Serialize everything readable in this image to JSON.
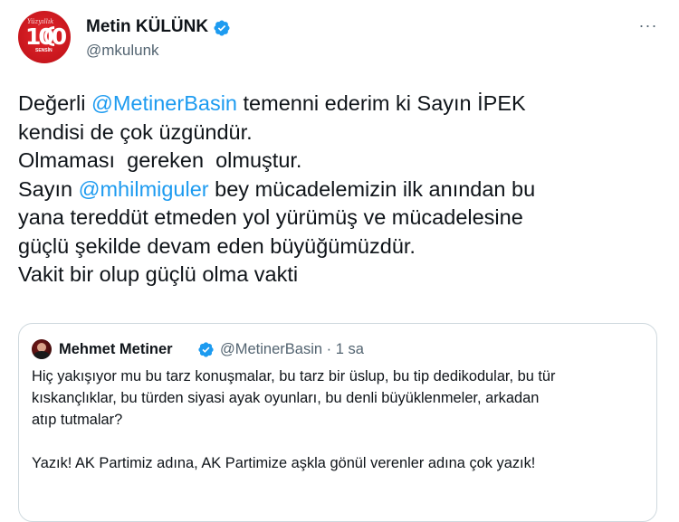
{
  "colors": {
    "accent": "#1d9bf0",
    "text": "#0f1419",
    "secondary": "#536471",
    "border": "#cfd9de",
    "avatar_red": "#c8161d"
  },
  "author": {
    "name": "Metin KÜLÜNK",
    "handle": "@mkulunk",
    "avatar_icon": "party-anniversary-logo-icon",
    "avatar_text": "100",
    "verified_icon": "verified-badge-icon",
    "more_icon": "more-options-icon",
    "more_glyph": "···"
  },
  "tweet": {
    "line1": {
      "before": "Değerli ",
      "mention": "@MetinerBasin",
      "after": " temenni ederim ki Sayın İPEK"
    },
    "line2": "kendisi de çok üzgündür.",
    "line3": "Olmaması  gereken  olmuştur.",
    "line4": {
      "before": "Sayın ",
      "mention": "@mhilmiguler",
      "after": " bey mücadelemizin ilk anından bu"
    },
    "line5": "yana tereddüt etmeden yol yürümüş ve mücadelesine",
    "line6": "güçlü şekilde devam eden büyüğümüzdür.",
    "line7": "Vakit bir olup güçlü olma vakti"
  },
  "quoted": {
    "name": "Mehmet Metiner",
    "handle": "@MetinerBasin",
    "separator": " · ",
    "time": "1 sa",
    "verified_icon": "verified-badge-icon",
    "line1": "Hiç yakışıyor mu bu tarz konuşmalar, bu tarz bir üslup, bu tip dedikodular, bu tür",
    "line2": "kıskançlıklar, bu türden siyasi ayak oyunları, bu denli büyüklenmeler, arkadan",
    "line3": "atıp tutmalar?",
    "line4": "Yazık! AK Partimiz adına, AK Partimize aşkla gönül verenler adına çok yazık!"
  }
}
